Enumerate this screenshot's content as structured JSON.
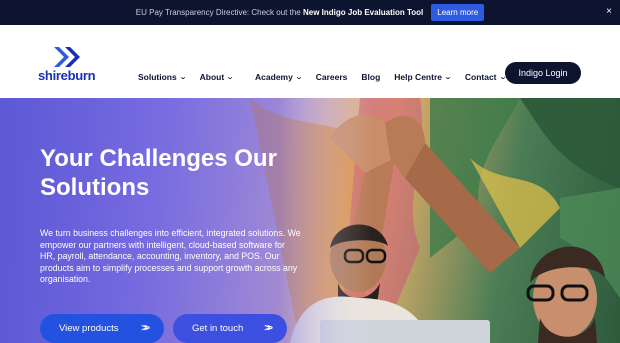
{
  "announcement": {
    "message": "EU Pay Transparency Directive: Check out the",
    "highlight": "New Indigo Job Evaluation Tool",
    "button_label": "Learn more",
    "close_symbol": "×"
  },
  "brand": {
    "name": "shireburn",
    "primary_color": "#1a2fb8",
    "dark_color": "#0d1430",
    "accent_color": "#2452e0"
  },
  "nav": {
    "items": [
      {
        "label": "Solutions",
        "has_dropdown": true
      },
      {
        "label": "About",
        "has_dropdown": true
      },
      {
        "label": "Academy",
        "has_dropdown": true
      },
      {
        "label": "Careers",
        "has_dropdown": false
      },
      {
        "label": "Blog",
        "has_dropdown": false
      },
      {
        "label": "Help Centre",
        "has_dropdown": true
      },
      {
        "label": "Contact",
        "has_dropdown": true
      }
    ],
    "chevron": "⌄",
    "login_label": "Indigo Login"
  },
  "hero": {
    "title": "Your Challenges Our Solutions",
    "body": "We turn business challenges into efficient, integrated solutions. We empower our partners with intelligent, cloud-based software for HR, payroll, attendance, accounting, inventory, and POS. Our products aim to simplify processes and support growth across any organisation.",
    "primary_button": "View products",
    "secondary_button": "Get in touch",
    "arrow_glyph": "»"
  }
}
